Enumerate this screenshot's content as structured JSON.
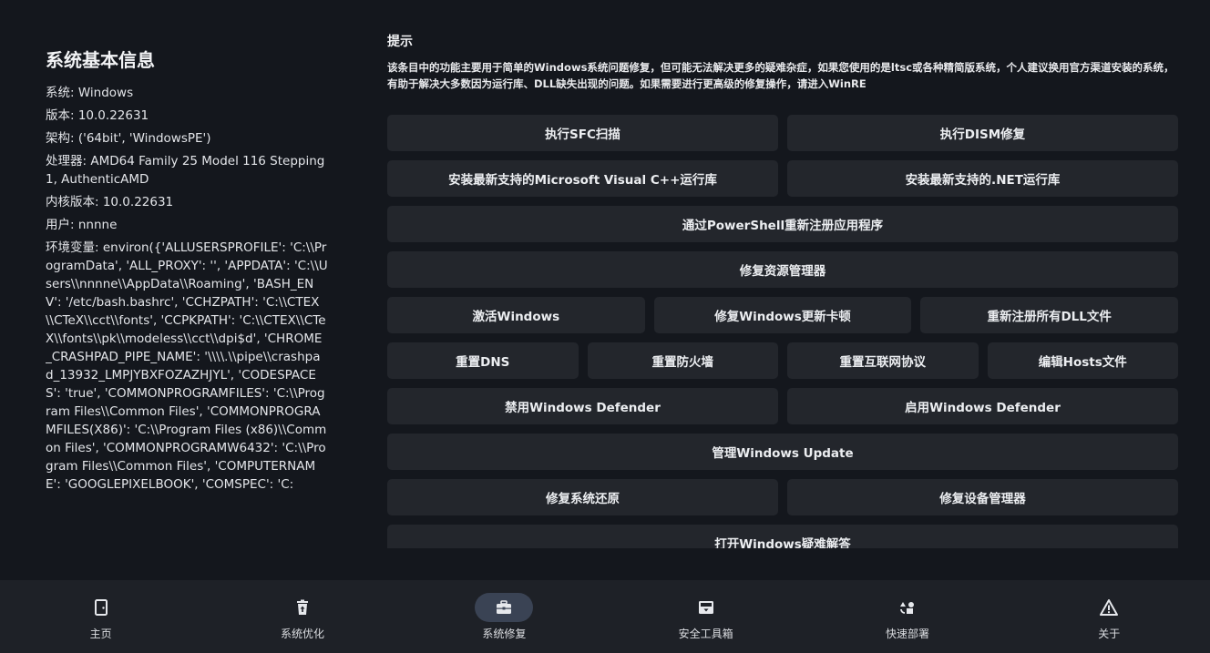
{
  "system_info": {
    "title": "系统基本信息",
    "lines": [
      "系统: Windows",
      "版本: 10.0.22631",
      "架构: ('64bit', 'WindowsPE')",
      "处理器: AMD64 Family 25 Model 116 Stepping 1, AuthenticAMD",
      "内核版本: 10.0.22631",
      "用户: nnnne"
    ],
    "env": "环境变量: environ({'ALLUSERSPROFILE': 'C:\\\\ProgramData', 'ALL_PROXY': '', 'APPDATA': 'C:\\\\Users\\\\nnnne\\\\AppData\\\\Roaming', 'BASH_ENV': '/etc/bash.bashrc', 'CCHZPATH': 'C:\\\\CTEX\\\\CTeX\\\\cct\\\\fonts', 'CCPKPATH': 'C:\\\\CTEX\\\\CTeX\\\\fonts\\\\pk\\\\modeless\\\\cct\\\\dpi$d', 'CHROME_CRASHPAD_PIPE_NAME': '\\\\\\\\.\\\\pipe\\\\crashpad_13932_LMPJYBXFOZAZHJYL', 'CODESPACES': 'true', 'COMMONPROGRAMFILES': 'C:\\\\Program Files\\\\Common Files', 'COMMONPROGRAMFILES(X86)': 'C:\\\\Program Files (x86)\\\\Common Files', 'COMMONPROGRAMW6432': 'C:\\\\Program Files\\\\Common Files', 'COMPUTERNAME': 'GOOGLEPIXELBOOK', 'COMSPEC': 'C:"
  },
  "tip": {
    "title": "提示",
    "text": "该条目中的功能主要用于简单的Windows系统问题修复，但可能无法解决更多的疑难杂症，如果您使用的是ltsc或各种精简版系统，个人建议换用官方渠道安装的系统，有助于解决大多数因为运行库、DLL缺失出现的问题。如果需要进行更高级的修复操作，请进入WinRE"
  },
  "buttons": {
    "sfc": "执行SFC扫描",
    "dism": "执行DISM修复",
    "vcpp": "安装最新支持的Microsoft Visual C++运行库",
    "dotnet": "安装最新支持的.NET运行库",
    "powershell": "通过PowerShell重新注册应用程序",
    "explorer": "修复资源管理器",
    "activate": "激活Windows",
    "update_stuck": "修复Windows更新卡顿",
    "dll": "重新注册所有DLL文件",
    "dns": "重置DNS",
    "firewall": "重置防火墙",
    "internet": "重置互联网协议",
    "hosts": "编辑Hosts文件",
    "disable_defender": "禁用Windows Defender",
    "enable_defender": "启用Windows Defender",
    "manage_update": "管理Windows Update",
    "restore": "修复系统还原",
    "device_manager": "修复设备管理器",
    "troubleshoot": "打开Windows疑难解答"
  },
  "nav": {
    "home": "主页",
    "optimize": "系统优化",
    "repair": "系统修复",
    "security": "安全工具箱",
    "deploy": "快速部署",
    "about": "关于",
    "active": "repair"
  }
}
